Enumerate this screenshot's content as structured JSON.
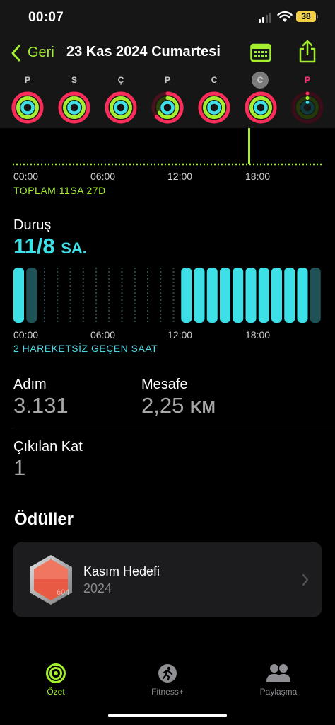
{
  "status_bar": {
    "time": "00:07",
    "battery": "38"
  },
  "header": {
    "back_label": "Geri",
    "title": "23 Kas 2024 Cumartesi"
  },
  "week_days": [
    "P",
    "S",
    "Ç",
    "P",
    "C",
    "C",
    "P"
  ],
  "selected_day_index": 5,
  "move_chart": {
    "x_labels": [
      "00:00",
      "06:00",
      "12:00",
      "18:00"
    ],
    "caption": "TOPLAM 11SA 27D"
  },
  "stand": {
    "title": "Duruş",
    "value": "11/8",
    "unit": "SA.",
    "x_labels": [
      "00:00",
      "06:00",
      "12:00",
      "18:00"
    ],
    "caption": "2 HAREKETSİZ GEÇEN SAAT"
  },
  "stats": {
    "steps_label": "Adım",
    "steps_value": "3.131",
    "distance_label": "Mesafe",
    "distance_value": "2,25",
    "distance_unit": "KM",
    "floors_label": "Çıkılan Kat",
    "floors_value": "1"
  },
  "awards": {
    "title": "Ödüller",
    "item_name": "Kasım Hedefi",
    "item_year": "2024",
    "badge_text": "604"
  },
  "tabs": [
    {
      "label": "Özet",
      "active": true
    },
    {
      "label": "Fitness+",
      "active": false
    },
    {
      "label": "Paylaşma",
      "active": false
    }
  ],
  "colors": {
    "accent": "#a2ee2f",
    "move": "#fa2d5a",
    "exercise": "#a2ee2f",
    "stand": "#3ee0e8"
  }
}
